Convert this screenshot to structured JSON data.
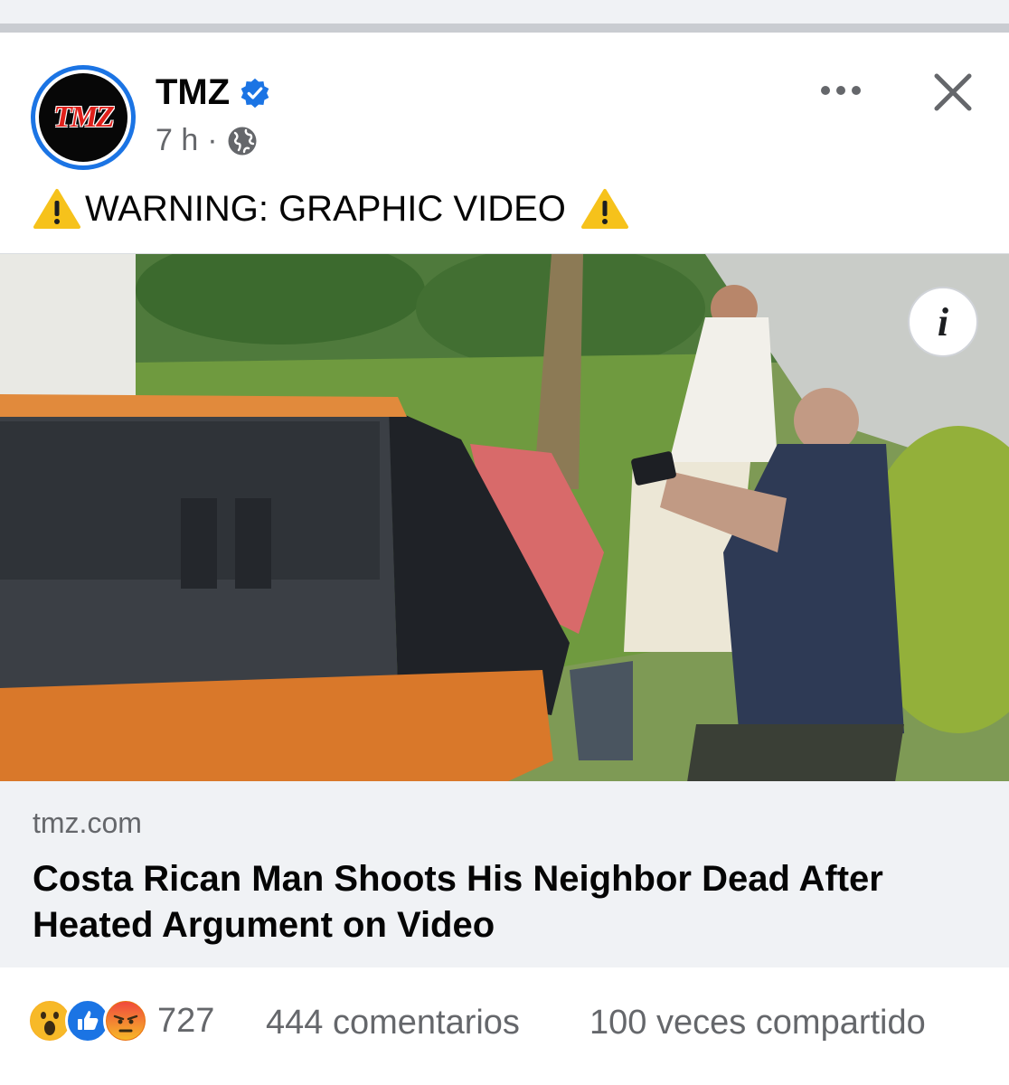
{
  "post": {
    "author": {
      "name": "TMZ",
      "logo_text": "TMZ",
      "verified": true,
      "verified_color": "#1b74e4"
    },
    "time": "7 h",
    "separator": "·",
    "audience_icon": "globe-icon",
    "text": "WARNING: GRAPHIC VIDEO",
    "warning_emoji": "warning-sign-icon",
    "media": {
      "info_label": "i"
    },
    "link": {
      "domain": "tmz.com",
      "title": "Costa Rican Man Shoots His Neighbor Dead After Heated Argument on Video"
    },
    "stats": {
      "reaction_icons": [
        "wow-reaction-icon",
        "like-reaction-icon",
        "angry-reaction-icon"
      ],
      "reactions_count": "727",
      "comments": "444 comentarios",
      "shares": "100 veces compartido"
    }
  },
  "colors": {
    "accent": "#1b74e4",
    "secondary_text": "#65676b",
    "link_bg": "#f0f2f5"
  }
}
